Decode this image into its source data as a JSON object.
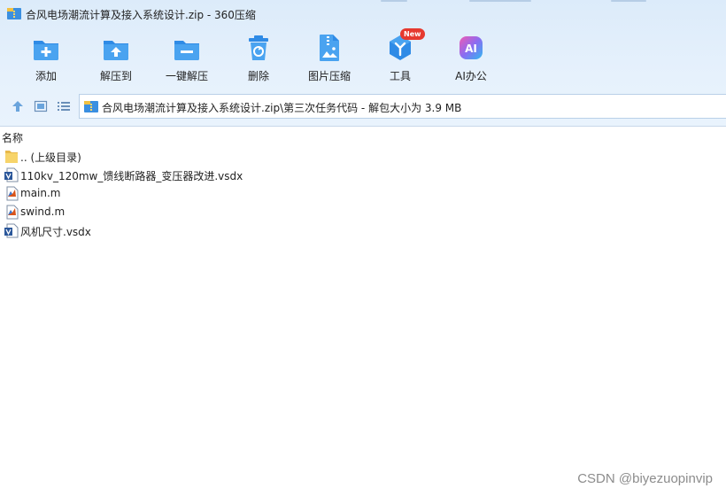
{
  "window": {
    "title": "合风电场潮流计算及接入系统设计.zip - 360压缩"
  },
  "toolbar": {
    "items": [
      {
        "label": "添加",
        "icon": "add-icon"
      },
      {
        "label": "解压到",
        "icon": "extract-to-icon"
      },
      {
        "label": "一键解压",
        "icon": "one-click-extract-icon"
      },
      {
        "label": "删除",
        "icon": "delete-icon"
      },
      {
        "label": "图片压缩",
        "icon": "image-compress-icon"
      },
      {
        "label": "工具",
        "icon": "tools-icon",
        "badge": "New"
      },
      {
        "label": "AI办公",
        "icon": "ai-office-icon",
        "icon_text": "AI"
      }
    ]
  },
  "address": {
    "path": "合风电场潮流计算及接入系统设计.zip\\第三次任务代码 - 解包大小为 3.9 MB"
  },
  "list": {
    "column_name": "名称",
    "files": [
      {
        "name": ".. (上级目录)",
        "type": "folder"
      },
      {
        "name": "110kv_120mw_馈线断路器_变压器改进.vsdx",
        "type": "visio"
      },
      {
        "name": "main.m",
        "type": "matlab"
      },
      {
        "name": "swind.m",
        "type": "matlab"
      },
      {
        "name": "风机尺寸.vsdx",
        "type": "visio"
      }
    ]
  },
  "watermark": "CSDN @biyezuopinvip",
  "colors": {
    "chrome_bg": "#e6f1fc",
    "icon_blue": "#2f8be6",
    "icon_light_blue": "#4aa3f0",
    "badge_red": "#e6392f",
    "folder_yellow": "#f7d46a"
  }
}
